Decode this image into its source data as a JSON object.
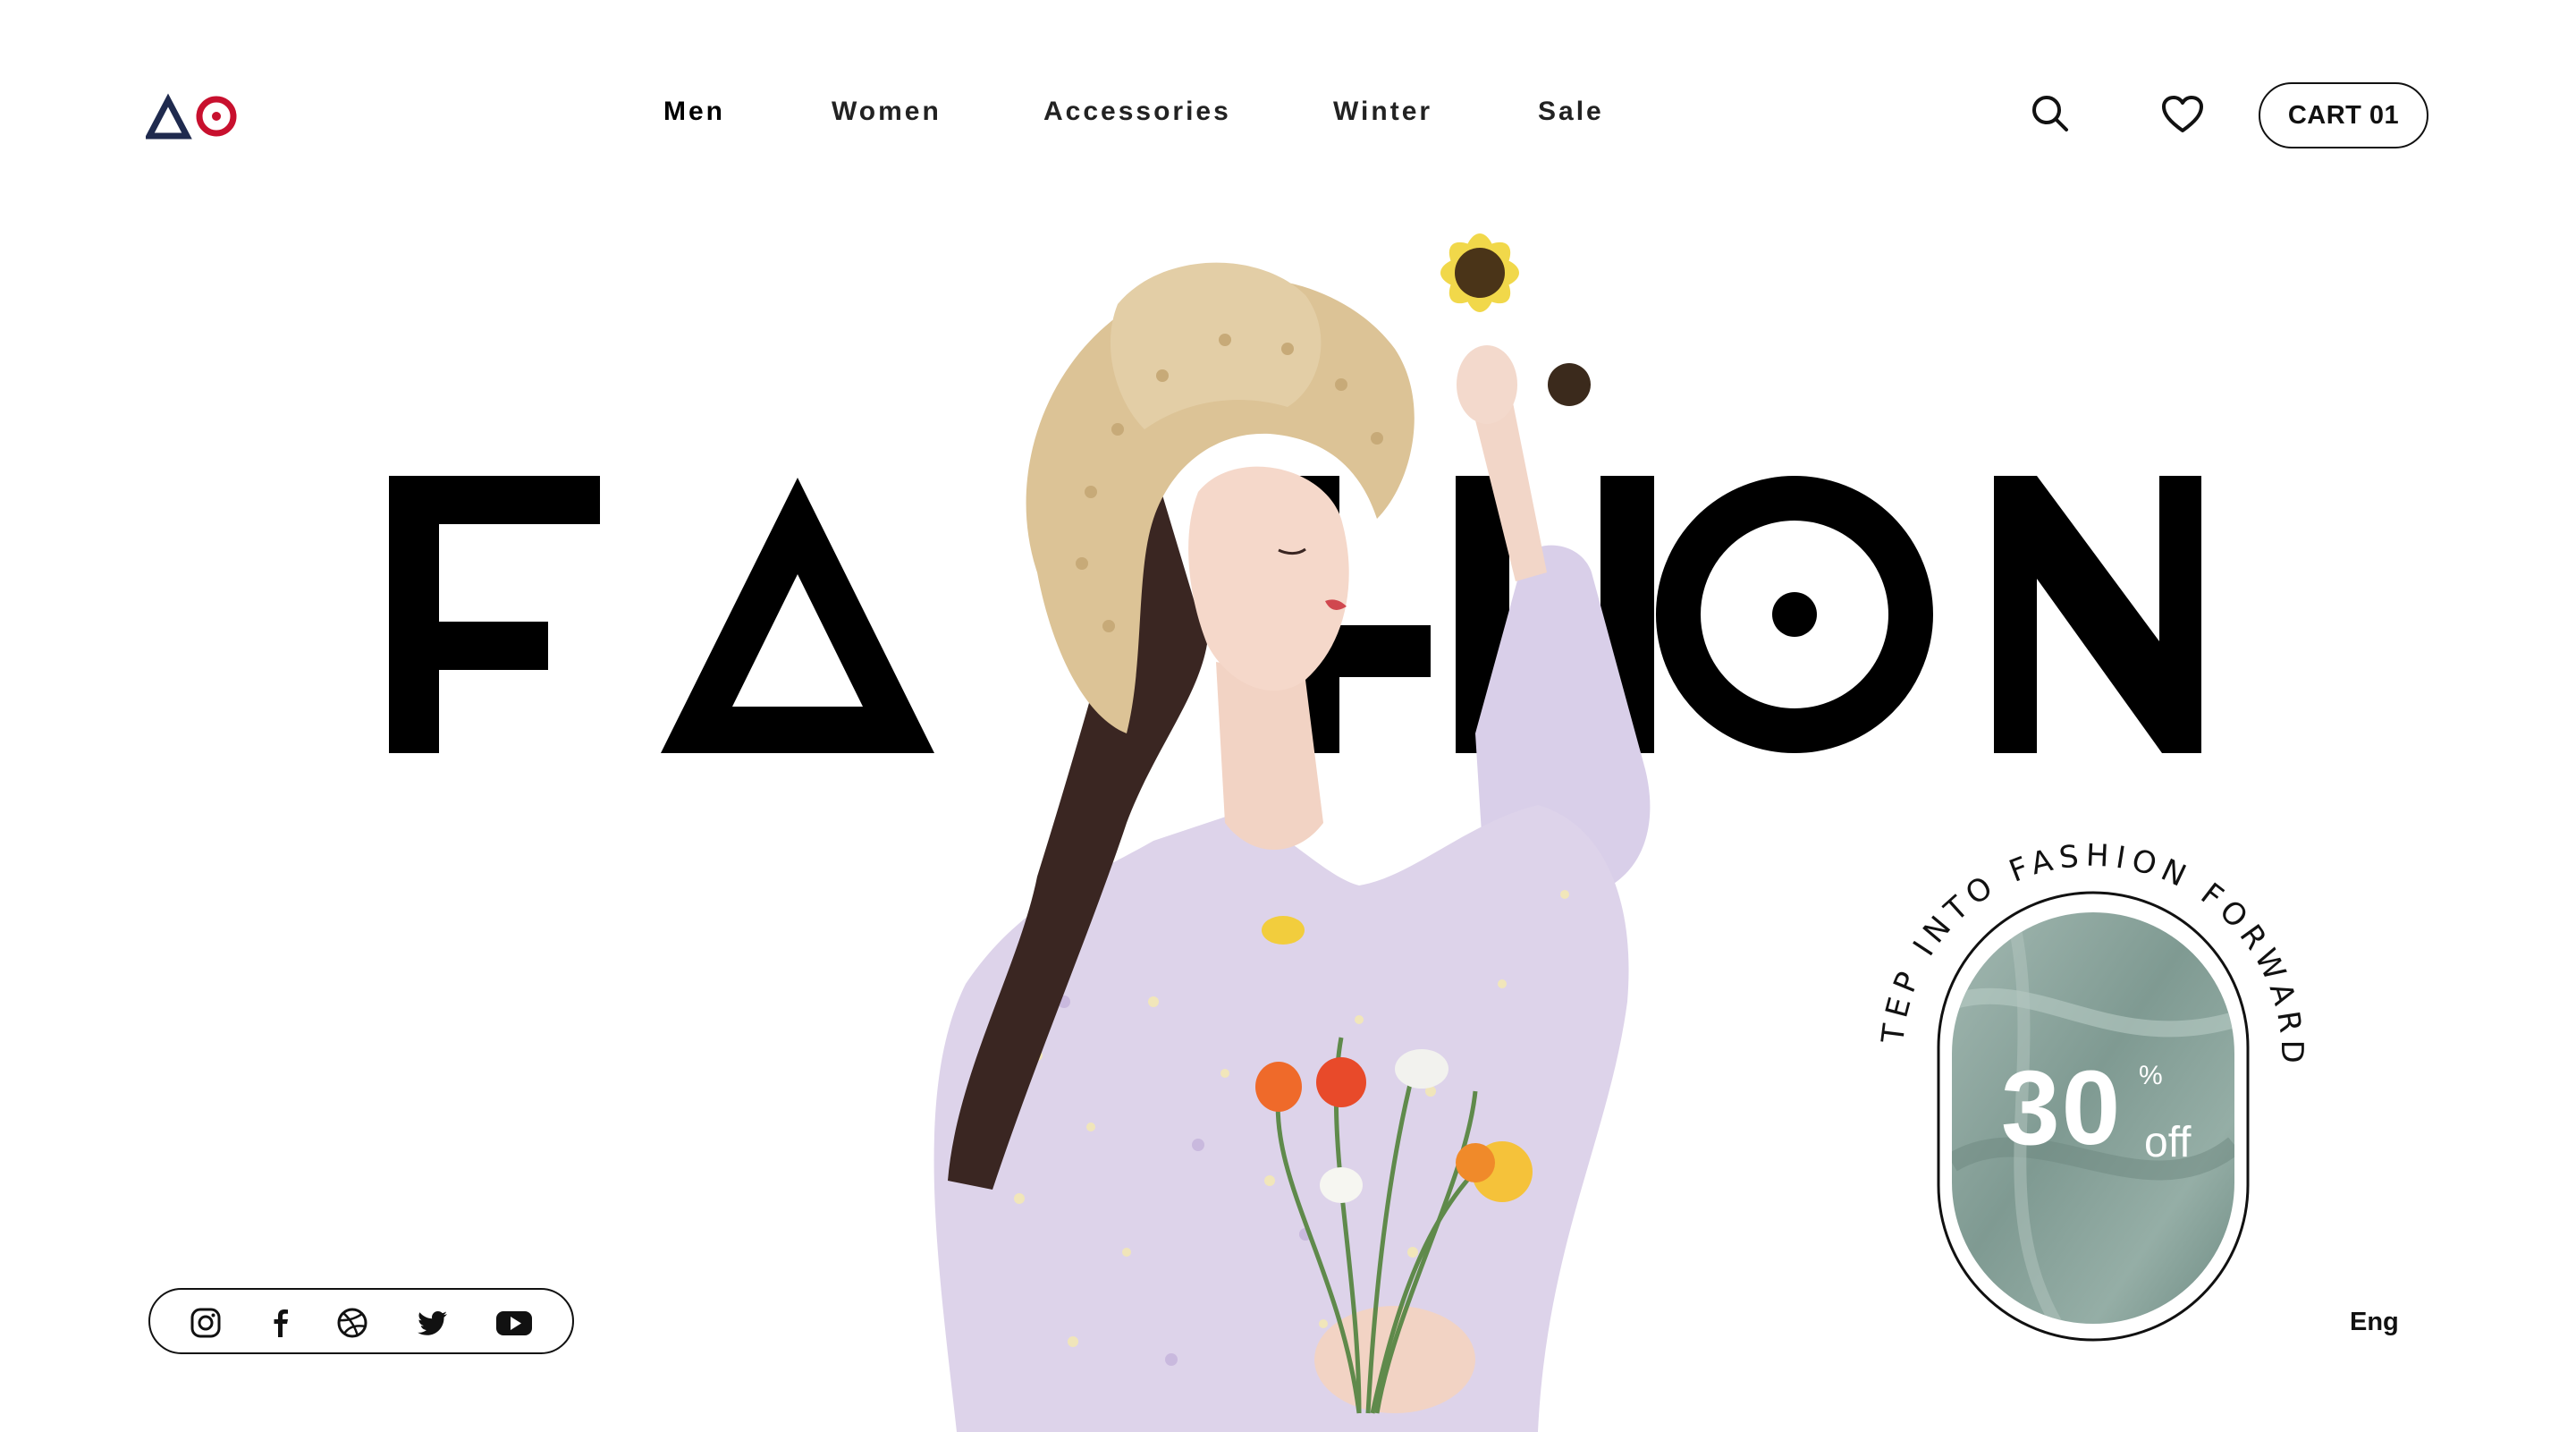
{
  "brand": {
    "logo_letters": "AO",
    "triangle_color": "#1f2a4e",
    "ring_color": "#c8102e"
  },
  "nav": {
    "items": [
      {
        "label": "Men",
        "active": true
      },
      {
        "label": "Women",
        "active": false
      },
      {
        "label": "Accessories",
        "active": false
      },
      {
        "label": "Winter",
        "active": false
      },
      {
        "label": "Sale",
        "active": false
      }
    ]
  },
  "header_actions": {
    "search_icon": "search-icon",
    "wishlist_icon": "heart-icon",
    "cart_label": "CART 01"
  },
  "hero": {
    "headline": "FASHION",
    "image_description_icon": "model-photo"
  },
  "promo": {
    "curved_text": "STEP INTO FASHION FORWARD",
    "value": "30",
    "percent_symbol": "%",
    "suffix": "off",
    "fabric_color": "#8ea79f"
  },
  "social": {
    "icons": [
      "instagram-icon",
      "facebook-icon",
      "dribbble-icon",
      "twitter-icon",
      "youtube-icon"
    ]
  },
  "language": {
    "label": "Eng"
  }
}
